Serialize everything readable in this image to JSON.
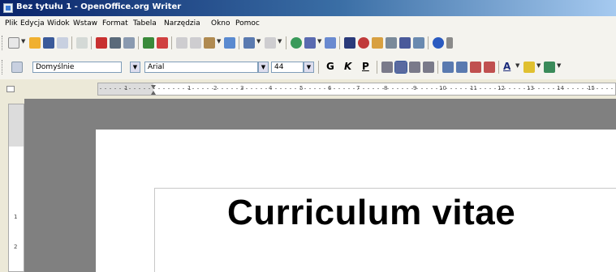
{
  "window": {
    "title": "Bez tytułu 1 - OpenOffice.org Writer"
  },
  "menu": {
    "items": [
      "Plik",
      "Edycja",
      "Widok",
      "Wstaw",
      "Format",
      "Tabela",
      "Narzędzia",
      "Okno",
      "Pomoc"
    ]
  },
  "toolbar2": {
    "style": "Domyślnie",
    "font": "Arial",
    "size": "44"
  },
  "ruler": {
    "labels": [
      "1",
      "1",
      "2",
      "3",
      "4",
      "5",
      "6",
      "7",
      "8",
      "9",
      "10",
      "11",
      "12",
      "13",
      "14",
      "15"
    ],
    "vlabels": [
      "1",
      "2"
    ]
  },
  "document": {
    "title": "Curriculum vitae"
  },
  "colors": {
    "titlebar": "#0a246a",
    "toolbar": "#f4f3ee",
    "workspace": "#808080"
  }
}
